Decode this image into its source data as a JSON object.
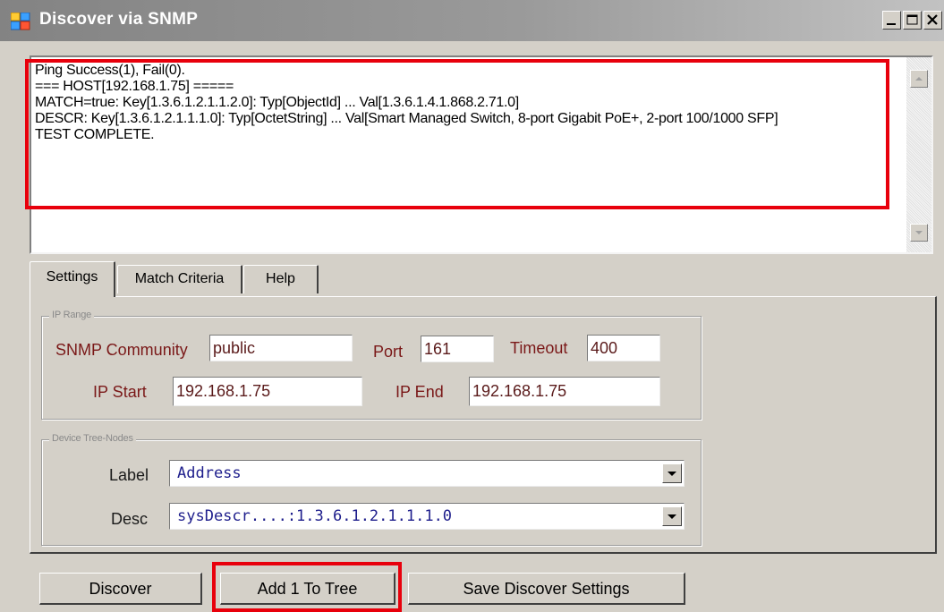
{
  "window": {
    "title": "Discover via SNMP",
    "icon": "app-window-icon"
  },
  "output": {
    "lines": [
      "Ping Success(1), Fail(0).",
      "=== HOST[192.168.1.75] =====",
      "MATCH=true: Key[1.3.6.1.2.1.1.2.0]: Typ[ObjectId] ... Val[1.3.6.1.4.1.868.2.71.0]",
      "DESCR: Key[1.3.6.1.2.1.1.1.0]: Typ[OctetString] ... Val[Smart Managed Switch, 8-port Gigabit PoE+, 2-port 100/1000 SFP]",
      "TEST COMPLETE."
    ]
  },
  "tabs": {
    "settings": "Settings",
    "match": "Match Criteria",
    "help": "Help"
  },
  "ip_range": {
    "title": "IP Range",
    "community_label": "SNMP Community",
    "community_value": "public",
    "port_label": "Port",
    "port_value": "161",
    "timeout_label": "Timeout",
    "timeout_value": "400",
    "ip_start_label": "IP Start",
    "ip_start_value": "192.168.1.75",
    "ip_end_label": "IP End",
    "ip_end_value": "192.168.1.75"
  },
  "tree_nodes": {
    "title": "Device Tree-Nodes",
    "label_label": "Label",
    "label_value": "Address",
    "desc_label": "Desc",
    "desc_value": "sysDescr....:1.3.6.1.2.1.1.1.0"
  },
  "buttons": {
    "discover": "Discover",
    "add": "Add 1 To Tree",
    "save": "Save Discover Settings"
  },
  "colors": {
    "highlight": "#e8000c",
    "label_text": "#7a1818",
    "combo_text": "#1e1e8c"
  }
}
